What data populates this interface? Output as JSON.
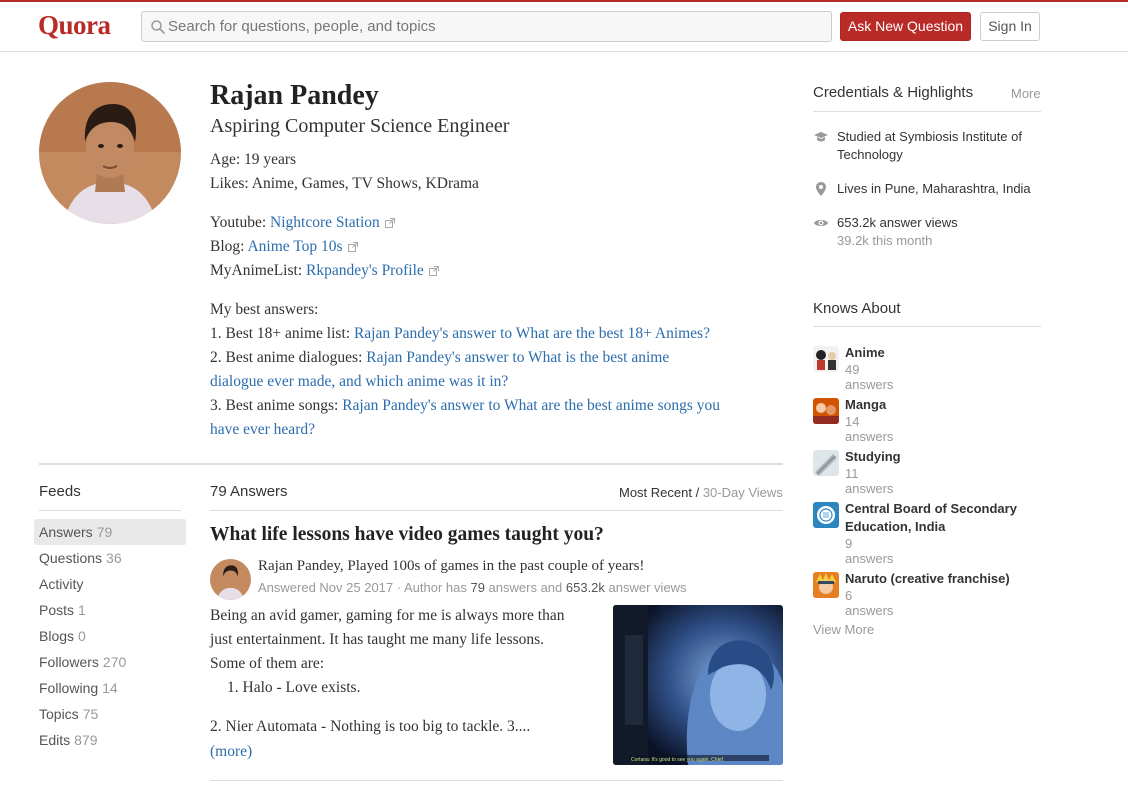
{
  "header": {
    "logo": "Quora",
    "search_placeholder": "Search for questions, people, and topics",
    "ask_label": "Ask New Question",
    "signin_label": "Sign In"
  },
  "profile": {
    "name": "Rajan Pandey",
    "tagline": "Aspiring Computer Science Engineer",
    "age": "Age: 19 years",
    "likes": "Likes: Anime, Games, TV Shows, KDrama",
    "links": [
      {
        "label": "Youtube: ",
        "text": "Nightcore Station"
      },
      {
        "label": "Blog: ",
        "text": "Anime Top 10s"
      },
      {
        "label": "MyAnimeList: ",
        "text": "Rkpandey's Profile"
      }
    ],
    "best_answers_heading": "My best answers:",
    "best_answers": [
      {
        "prefix": "1. Best 18+ anime list: ",
        "link": "Rajan Pandey's answer to What are the best 18+ Animes?"
      },
      {
        "prefix": "2. Best anime dialogues: ",
        "link_line1": "Rajan Pandey's answer to What is the best anime",
        "link_line2": "dialogue ever made, and which anime was it in?"
      },
      {
        "prefix": "3. Best anime songs: ",
        "link_line1": "Rajan Pandey's answer to What are the best anime songs you",
        "link_line2": "have ever heard?"
      }
    ]
  },
  "feeds": {
    "title": "Feeds",
    "items": [
      {
        "label": "Answers",
        "count": "79"
      },
      {
        "label": "Questions",
        "count": "36"
      },
      {
        "label": "Activity",
        "count": ""
      },
      {
        "label": "Posts",
        "count": "1"
      },
      {
        "label": "Blogs",
        "count": "0"
      },
      {
        "label": "Followers",
        "count": "270"
      },
      {
        "label": "Following",
        "count": "14"
      },
      {
        "label": "Topics",
        "count": "75"
      },
      {
        "label": "Edits",
        "count": "879"
      }
    ]
  },
  "answers": {
    "count_label": "79 Answers",
    "sort_active": "Most Recent",
    "sort_separator": " / ",
    "sort_inactive": "30-Day Views",
    "question_title": "What life lessons have video games taught you?",
    "author_credential": "Rajan Pandey, Played 100s of games in the past couple of years!",
    "meta_prefix": "Answered Nov 25 2017 · Author has ",
    "meta_answers": "79",
    "meta_mid": " answers and ",
    "meta_views": "653.2k",
    "meta_suffix": " answer views",
    "body_lines": [
      "Being an avid gamer, gaming for me is always more than",
      "just entertainment. It has taught me many life lessons.",
      "Some of them are:",
      "1. Halo - Love exists.",
      "2. Nier Automata - Nothing is too big to tackle. 3...."
    ],
    "more_label": "(more)",
    "image_caption": "Cortana: It's good to see you again, Chief."
  },
  "credentials": {
    "title": "Credentials & Highlights",
    "more_label": "More",
    "items": [
      {
        "icon": "graduation-cap-icon",
        "text": "Studied at Symbiosis Institute of Technology",
        "sub": ""
      },
      {
        "icon": "location-pin-icon",
        "text": "Lives in Pune, Maharashtra, India",
        "sub": ""
      },
      {
        "icon": "eye-icon",
        "text": "653.2k answer views",
        "sub": "39.2k this month"
      }
    ]
  },
  "knows_about": {
    "title": "Knows About",
    "topics": [
      {
        "name": "Anime",
        "count": "49 answers"
      },
      {
        "name": "Manga",
        "count": "14 answers"
      },
      {
        "name": "Studying",
        "count": "11 answers"
      },
      {
        "name": "Central Board of Secondary Education, India",
        "count": "9 answers"
      },
      {
        "name": "Naruto (creative franchise)",
        "count": "6 answers"
      }
    ],
    "view_more_label": "View More"
  },
  "colors": {
    "brand": "#b92b27",
    "link": "#2b6dad"
  }
}
